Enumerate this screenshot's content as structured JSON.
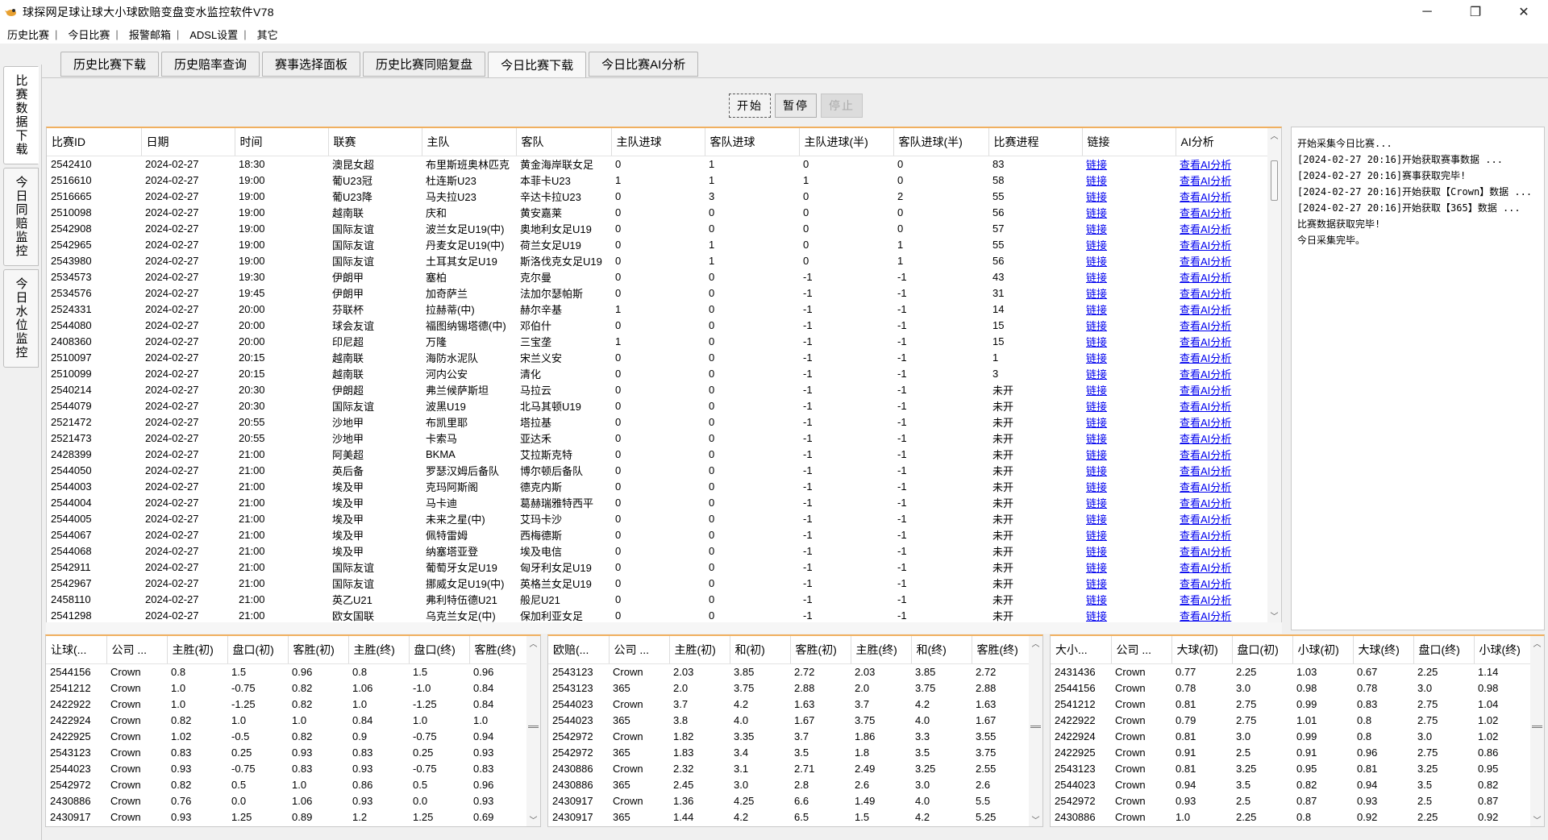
{
  "window": {
    "title": "球探网足球让球大小球欧赔变盘变水监控软件V78",
    "minimize": "─",
    "maximize": "❐",
    "close": "✕"
  },
  "menu": [
    "历史比赛",
    "今日比赛",
    "报警邮箱",
    "ADSL设置",
    "其它"
  ],
  "sidetabs": [
    "比赛数据下载",
    "今日同赔监控",
    "今日水位监控"
  ],
  "tabs": [
    "历史比赛下载",
    "历史赔率查询",
    "赛事选择面板",
    "历史比赛同赔复盘",
    "今日比赛下载",
    "今日比赛AI分析"
  ],
  "active_tab": 4,
  "buttons": {
    "start": "开始",
    "pause": "暂停",
    "stop": "停止"
  },
  "main_table": {
    "columns": [
      "比赛ID",
      "日期",
      "时间",
      "联赛",
      "主队",
      "客队",
      "主队进球",
      "客队进球",
      "主队进球(半)",
      "客队进球(半)",
      "比赛进程",
      "链接",
      "AI分析"
    ],
    "rows": [
      [
        "2542410",
        "2024-02-27",
        "18:30",
        "澳昆女超",
        "布里斯班奥林匹克",
        "黄金海岸联女足",
        "0",
        "1",
        "0",
        "0",
        "83",
        "链接",
        "查看AI分析"
      ],
      [
        "2516610",
        "2024-02-27",
        "19:00",
        "葡U23冠",
        "杜连斯U23",
        "本菲卡U23",
        "1",
        "1",
        "1",
        "0",
        "58",
        "链接",
        "查看AI分析"
      ],
      [
        "2516665",
        "2024-02-27",
        "19:00",
        "葡U23降",
        "马夫拉U23",
        "辛达卡拉U23",
        "0",
        "3",
        "0",
        "2",
        "55",
        "链接",
        "查看AI分析"
      ],
      [
        "2510098",
        "2024-02-27",
        "19:00",
        "越南联",
        "庆和",
        "黄安嘉莱",
        "0",
        "0",
        "0",
        "0",
        "56",
        "链接",
        "查看AI分析"
      ],
      [
        "2542908",
        "2024-02-27",
        "19:00",
        "国际友谊",
        "波兰女足U19(中)",
        "奥地利女足U19",
        "0",
        "0",
        "0",
        "0",
        "57",
        "链接",
        "查看AI分析"
      ],
      [
        "2542965",
        "2024-02-27",
        "19:00",
        "国际友谊",
        "丹麦女足U19(中)",
        "荷兰女足U19",
        "0",
        "1",
        "0",
        "1",
        "55",
        "链接",
        "查看AI分析"
      ],
      [
        "2543980",
        "2024-02-27",
        "19:00",
        "国际友谊",
        "土耳其女足U19",
        "斯洛伐克女足U19",
        "0",
        "1",
        "0",
        "1",
        "56",
        "链接",
        "查看AI分析"
      ],
      [
        "2534573",
        "2024-02-27",
        "19:30",
        "伊朗甲",
        "塞柏",
        "克尔曼",
        "0",
        "0",
        "-1",
        "-1",
        "43",
        "链接",
        "查看AI分析"
      ],
      [
        "2534576",
        "2024-02-27",
        "19:45",
        "伊朗甲",
        "加奇萨兰",
        "法加尔瑟帕斯",
        "0",
        "0",
        "-1",
        "-1",
        "31",
        "链接",
        "查看AI分析"
      ],
      [
        "2524331",
        "2024-02-27",
        "20:00",
        "芬联杯",
        "拉赫蒂(中)",
        "赫尔辛基",
        "1",
        "0",
        "-1",
        "-1",
        "14",
        "链接",
        "查看AI分析"
      ],
      [
        "2544080",
        "2024-02-27",
        "20:00",
        "球会友谊",
        "福图纳锡塔德(中)",
        "邓伯什",
        "0",
        "0",
        "-1",
        "-1",
        "15",
        "链接",
        "查看AI分析"
      ],
      [
        "2408360",
        "2024-02-27",
        "20:00",
        "印尼超",
        "万隆",
        "三宝垄",
        "1",
        "0",
        "-1",
        "-1",
        "15",
        "链接",
        "查看AI分析"
      ],
      [
        "2510097",
        "2024-02-27",
        "20:15",
        "越南联",
        "海防水泥队",
        "宋兰义安",
        "0",
        "0",
        "-1",
        "-1",
        "1",
        "链接",
        "查看AI分析"
      ],
      [
        "2510099",
        "2024-02-27",
        "20:15",
        "越南联",
        "河内公安",
        "清化",
        "0",
        "0",
        "-1",
        "-1",
        "3",
        "链接",
        "查看AI分析"
      ],
      [
        "2540214",
        "2024-02-27",
        "20:30",
        "伊朗超",
        "弗兰候萨斯坦",
        "马拉云",
        "0",
        "0",
        "-1",
        "-1",
        "未开",
        "链接",
        "查看AI分析"
      ],
      [
        "2544079",
        "2024-02-27",
        "20:30",
        "国际友谊",
        "波黑U19",
        "北马其顿U19",
        "0",
        "0",
        "-1",
        "-1",
        "未开",
        "链接",
        "查看AI分析"
      ],
      [
        "2521472",
        "2024-02-27",
        "20:55",
        "沙地甲",
        "布凯里耶",
        "塔拉基",
        "0",
        "0",
        "-1",
        "-1",
        "未开",
        "链接",
        "查看AI分析"
      ],
      [
        "2521473",
        "2024-02-27",
        "20:55",
        "沙地甲",
        "卡索马",
        "亚达禾",
        "0",
        "0",
        "-1",
        "-1",
        "未开",
        "链接",
        "查看AI分析"
      ],
      [
        "2428399",
        "2024-02-27",
        "21:00",
        "阿美超",
        "BKMA",
        "艾拉斯克特",
        "0",
        "0",
        "-1",
        "-1",
        "未开",
        "链接",
        "查看AI分析"
      ],
      [
        "2544050",
        "2024-02-27",
        "21:00",
        "英后备",
        "罗瑟汉姆后备队",
        "博尔顿后备队",
        "0",
        "0",
        "-1",
        "-1",
        "未开",
        "链接",
        "查看AI分析"
      ],
      [
        "2544003",
        "2024-02-27",
        "21:00",
        "埃及甲",
        "克玛阿斯阁",
        "德克内斯",
        "0",
        "0",
        "-1",
        "-1",
        "未开",
        "链接",
        "查看AI分析"
      ],
      [
        "2544004",
        "2024-02-27",
        "21:00",
        "埃及甲",
        "马卡迪",
        "葛赫瑞雅特西平",
        "0",
        "0",
        "-1",
        "-1",
        "未开",
        "链接",
        "查看AI分析"
      ],
      [
        "2544005",
        "2024-02-27",
        "21:00",
        "埃及甲",
        "未来之星(中)",
        "艾玛卡沙",
        "0",
        "0",
        "-1",
        "-1",
        "未开",
        "链接",
        "查看AI分析"
      ],
      [
        "2544067",
        "2024-02-27",
        "21:00",
        "埃及甲",
        "佩特雷姆",
        "西梅德斯",
        "0",
        "0",
        "-1",
        "-1",
        "未开",
        "链接",
        "查看AI分析"
      ],
      [
        "2544068",
        "2024-02-27",
        "21:00",
        "埃及甲",
        "纳塞塔亚登",
        "埃及电信",
        "0",
        "0",
        "-1",
        "-1",
        "未开",
        "链接",
        "查看AI分析"
      ],
      [
        "2542911",
        "2024-02-27",
        "21:00",
        "国际友谊",
        "葡萄牙女足U19",
        "匈牙利女足U19",
        "0",
        "0",
        "-1",
        "-1",
        "未开",
        "链接",
        "查看AI分析"
      ],
      [
        "2542967",
        "2024-02-27",
        "21:00",
        "国际友谊",
        "挪威女足U19(中)",
        "英格兰女足U19",
        "0",
        "0",
        "-1",
        "-1",
        "未开",
        "链接",
        "查看AI分析"
      ],
      [
        "2458110",
        "2024-02-27",
        "21:00",
        "英乙U21",
        "弗利特伍德U21",
        "般尼U21",
        "0",
        "0",
        "-1",
        "-1",
        "未开",
        "链接",
        "查看AI分析"
      ],
      [
        "2541298",
        "2024-02-27",
        "21:00",
        "欧女国联",
        "乌克兰女足(中)",
        "保加利亚女足",
        "0",
        "0",
        "-1",
        "-1",
        "未开",
        "链接",
        "查看AI分析"
      ]
    ]
  },
  "log": [
    "开始采集今日比赛...",
    "[2024-02-27 20:16]开始获取赛事数据 ...",
    "[2024-02-27 20:16]赛事获取完毕!",
    "[2024-02-27 20:16]开始获取【Crown】数据 ...",
    "[2024-02-27 20:16]开始获取【365】数据 ...",
    "比赛数据获取完毕!",
    "今日采集完毕。"
  ],
  "handicap_table": {
    "columns": [
      "让球(...",
      "公司 ...",
      "主胜(初)",
      "盘口(初)",
      "客胜(初)",
      "主胜(终)",
      "盘口(终)",
      "客胜(终)"
    ],
    "rows": [
      [
        "2544156",
        "Crown",
        "0.8",
        "1.5",
        "0.96",
        "0.8",
        "1.5",
        "0.96"
      ],
      [
        "2541212",
        "Crown",
        "1.0",
        "-0.75",
        "0.82",
        "1.06",
        "-1.0",
        "0.84"
      ],
      [
        "2422922",
        "Crown",
        "1.0",
        "-1.25",
        "0.82",
        "1.0",
        "-1.25",
        "0.84"
      ],
      [
        "2422924",
        "Crown",
        "0.82",
        "1.0",
        "1.0",
        "0.84",
        "1.0",
        "1.0"
      ],
      [
        "2422925",
        "Crown",
        "1.02",
        "-0.5",
        "0.82",
        "0.9",
        "-0.75",
        "0.94"
      ],
      [
        "2543123",
        "Crown",
        "0.83",
        "0.25",
        "0.93",
        "0.83",
        "0.25",
        "0.93"
      ],
      [
        "2544023",
        "Crown",
        "0.93",
        "-0.75",
        "0.83",
        "0.93",
        "-0.75",
        "0.83"
      ],
      [
        "2542972",
        "Crown",
        "0.82",
        "0.5",
        "1.0",
        "0.86",
        "0.5",
        "0.96"
      ],
      [
        "2430886",
        "Crown",
        "0.76",
        "0.0",
        "1.06",
        "0.93",
        "0.0",
        "0.93"
      ],
      [
        "2430917",
        "Crown",
        "0.93",
        "1.25",
        "0.89",
        "1.2",
        "1.25",
        "0.69"
      ]
    ]
  },
  "euro_table": {
    "columns": [
      "欧赔(...",
      "公司 ...",
      "主胜(初)",
      "和(初)",
      "客胜(初)",
      "主胜(终)",
      "和(终)",
      "客胜(终)"
    ],
    "rows": [
      [
        "2543123",
        "Crown",
        "2.03",
        "3.85",
        "2.72",
        "2.03",
        "3.85",
        "2.72"
      ],
      [
        "2543123",
        "365",
        "2.0",
        "3.75",
        "2.88",
        "2.0",
        "3.75",
        "2.88"
      ],
      [
        "2544023",
        "Crown",
        "3.7",
        "4.2",
        "1.63",
        "3.7",
        "4.2",
        "1.63"
      ],
      [
        "2544023",
        "365",
        "3.8",
        "4.0",
        "1.67",
        "3.75",
        "4.0",
        "1.67"
      ],
      [
        "2542972",
        "Crown",
        "1.82",
        "3.35",
        "3.7",
        "1.86",
        "3.3",
        "3.55"
      ],
      [
        "2542972",
        "365",
        "1.83",
        "3.4",
        "3.5",
        "1.8",
        "3.5",
        "3.75"
      ],
      [
        "2430886",
        "Crown",
        "2.32",
        "3.1",
        "2.71",
        "2.49",
        "3.25",
        "2.55"
      ],
      [
        "2430886",
        "365",
        "2.45",
        "3.0",
        "2.8",
        "2.6",
        "3.0",
        "2.6"
      ],
      [
        "2430917",
        "Crown",
        "1.36",
        "4.25",
        "6.6",
        "1.49",
        "4.0",
        "5.5"
      ],
      [
        "2430917",
        "365",
        "1.44",
        "4.2",
        "6.5",
        "1.5",
        "4.2",
        "5.25"
      ]
    ]
  },
  "ou_table": {
    "columns": [
      "大小...",
      "公司 ...",
      "大球(初)",
      "盘口(初)",
      "小球(初)",
      "大球(终)",
      "盘口(终)",
      "小球(终)"
    ],
    "rows": [
      [
        "2431436",
        "Crown",
        "0.77",
        "2.25",
        "1.03",
        "0.67",
        "2.25",
        "1.14"
      ],
      [
        "2544156",
        "Crown",
        "0.78",
        "3.0",
        "0.98",
        "0.78",
        "3.0",
        "0.98"
      ],
      [
        "2541212",
        "Crown",
        "0.81",
        "2.75",
        "0.99",
        "0.83",
        "2.75",
        "1.04"
      ],
      [
        "2422922",
        "Crown",
        "0.79",
        "2.75",
        "1.01",
        "0.8",
        "2.75",
        "1.02"
      ],
      [
        "2422924",
        "Crown",
        "0.81",
        "3.0",
        "0.99",
        "0.8",
        "3.0",
        "1.02"
      ],
      [
        "2422925",
        "Crown",
        "0.91",
        "2.5",
        "0.91",
        "0.96",
        "2.75",
        "0.86"
      ],
      [
        "2543123",
        "Crown",
        "0.81",
        "3.25",
        "0.95",
        "0.81",
        "3.25",
        "0.95"
      ],
      [
        "2544023",
        "Crown",
        "0.94",
        "3.5",
        "0.82",
        "0.94",
        "3.5",
        "0.82"
      ],
      [
        "2542972",
        "Crown",
        "0.93",
        "2.5",
        "0.87",
        "0.93",
        "2.5",
        "0.87"
      ],
      [
        "2430886",
        "Crown",
        "1.0",
        "2.25",
        "0.8",
        "0.92",
        "2.25",
        "0.92"
      ]
    ]
  }
}
